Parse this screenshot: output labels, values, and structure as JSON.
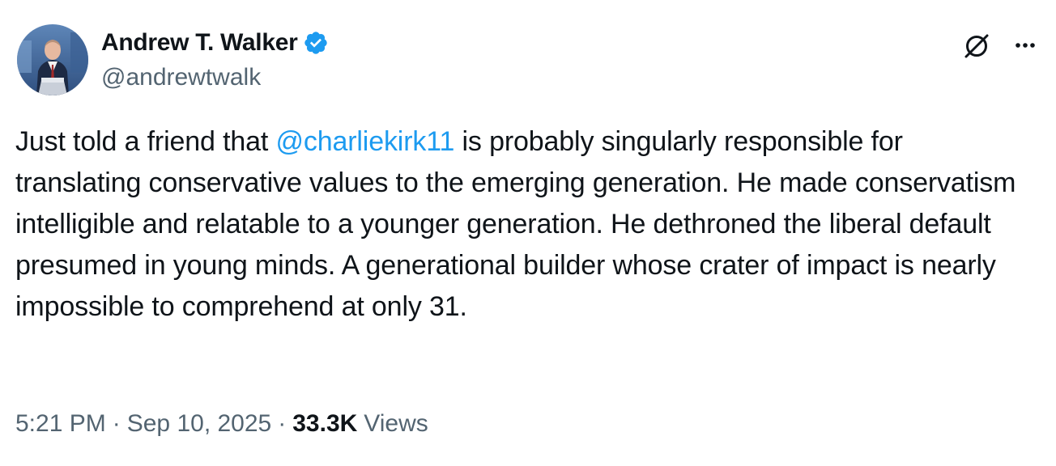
{
  "author": {
    "display_name": "Andrew T. Walker",
    "handle": "@andrewtwalk",
    "verified": true
  },
  "tweet": {
    "text_before": "Just told a friend that ",
    "mention": "@charliekirk11",
    "text_after": " is probably singularly responsible for translating conservative values to the emerging generation. He made conservatism intelligible and relatable to a younger generation. He dethroned the liberal default presumed in young minds. A generational builder whose crater of impact is nearly impossible to comprehend at only 31."
  },
  "meta": {
    "time": "5:21 PM",
    "date": "Sep 10, 2025",
    "separator": "·",
    "views_count": "33.3K",
    "views_label": "Views"
  },
  "icons": {
    "verified": "verified-badge-icon",
    "grok": "grok-icon",
    "more": "more-options-icon"
  },
  "colors": {
    "accent": "#1d9bf0",
    "text": "#0f1419",
    "muted": "#536471"
  }
}
